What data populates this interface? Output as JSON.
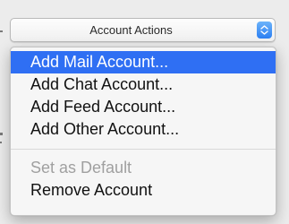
{
  "popup": {
    "label": "Account Actions",
    "accent_color": "#2f7ff2",
    "arrows_icon": "up-down-chevron-icon"
  },
  "menu": {
    "group1": [
      {
        "label": "Add Mail Account...",
        "state": "highlighted"
      },
      {
        "label": "Add Chat Account...",
        "state": "normal"
      },
      {
        "label": "Add Feed Account...",
        "state": "normal"
      },
      {
        "label": "Add Other Account...",
        "state": "normal"
      }
    ],
    "group2": [
      {
        "label": "Set as Default",
        "state": "disabled"
      },
      {
        "label": "Remove Account",
        "state": "normal"
      }
    ],
    "highlight_color": "#2f6ff3"
  }
}
